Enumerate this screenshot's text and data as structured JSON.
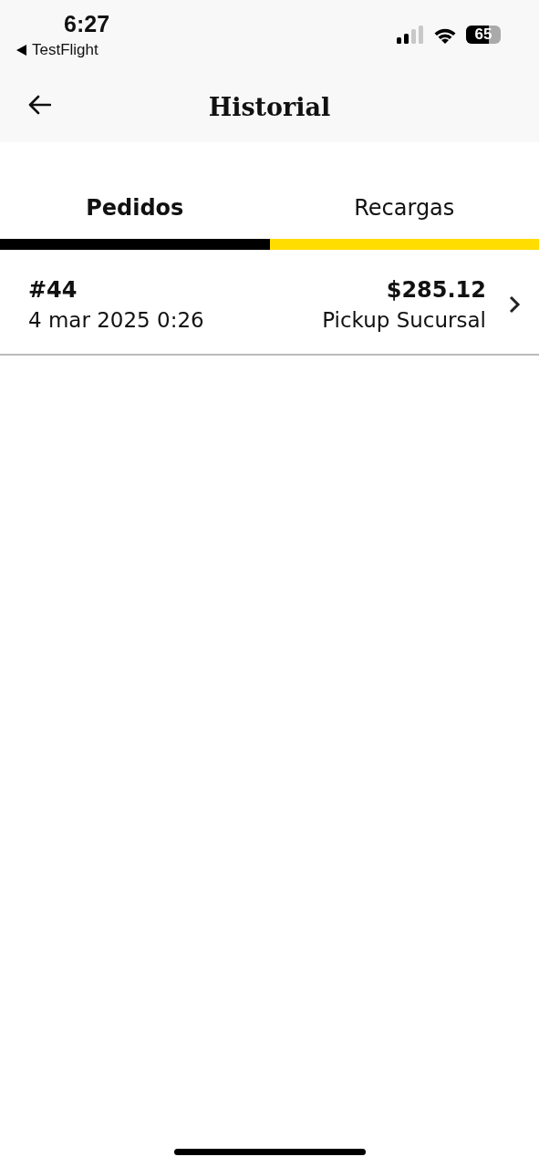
{
  "status_bar": {
    "time": "6:27",
    "back_app": "TestFlight",
    "battery": "65"
  },
  "header": {
    "title": "Historial"
  },
  "tabs": [
    {
      "label": "Pedidos",
      "selected": true
    },
    {
      "label": "Recargas",
      "selected": false
    }
  ],
  "orders": [
    {
      "number": "#44",
      "date": "4 mar 2025 0:26",
      "total": "$285.12",
      "delivery": "Pickup Sucursal"
    }
  ]
}
